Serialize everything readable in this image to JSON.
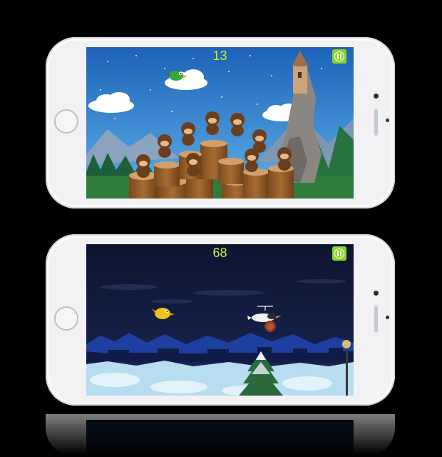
{
  "screens": {
    "top": {
      "score": "13",
      "theme": "day",
      "pause_icon": "pause-icon"
    },
    "bottom": {
      "score": "68",
      "theme": "night",
      "pause_icon": "pause-icon"
    }
  },
  "colors": {
    "score": "#c7ef3c",
    "pause_button": "#8cd329",
    "day_sky": "#2d7fd0",
    "night_sky": "#101b3c"
  }
}
